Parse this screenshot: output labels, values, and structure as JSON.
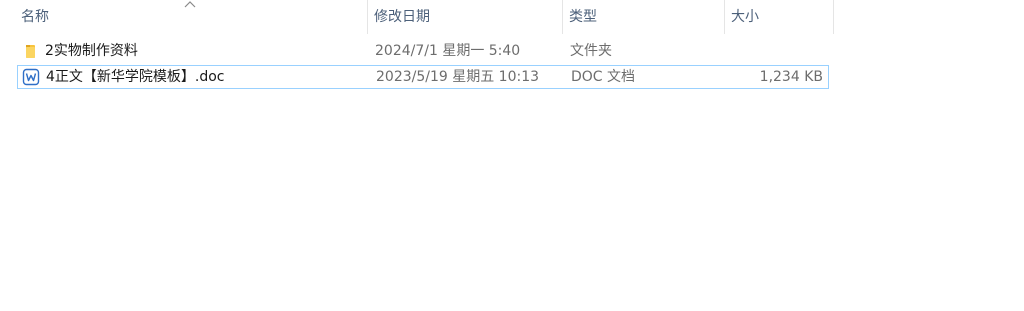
{
  "columns": {
    "name": "名称",
    "date": "修改日期",
    "type": "类型",
    "size": "大小"
  },
  "files": [
    {
      "name": "2实物制作资料",
      "date": "2024/7/1 星期一 5:40",
      "type": "文件夹",
      "size": "",
      "icon": "folder-icon"
    },
    {
      "name": "4正文【新华学院模板】.doc",
      "date": "2023/5/19 星期五 10:13",
      "type": "DOC 文档",
      "size": "1,234 KB",
      "icon": "wps-word-document-icon"
    }
  ],
  "colors": {
    "header_text": "#4c607a",
    "selection_border": "#99d1ff",
    "folder": "#f8c33d",
    "doc_icon": "#2f6fc7"
  }
}
